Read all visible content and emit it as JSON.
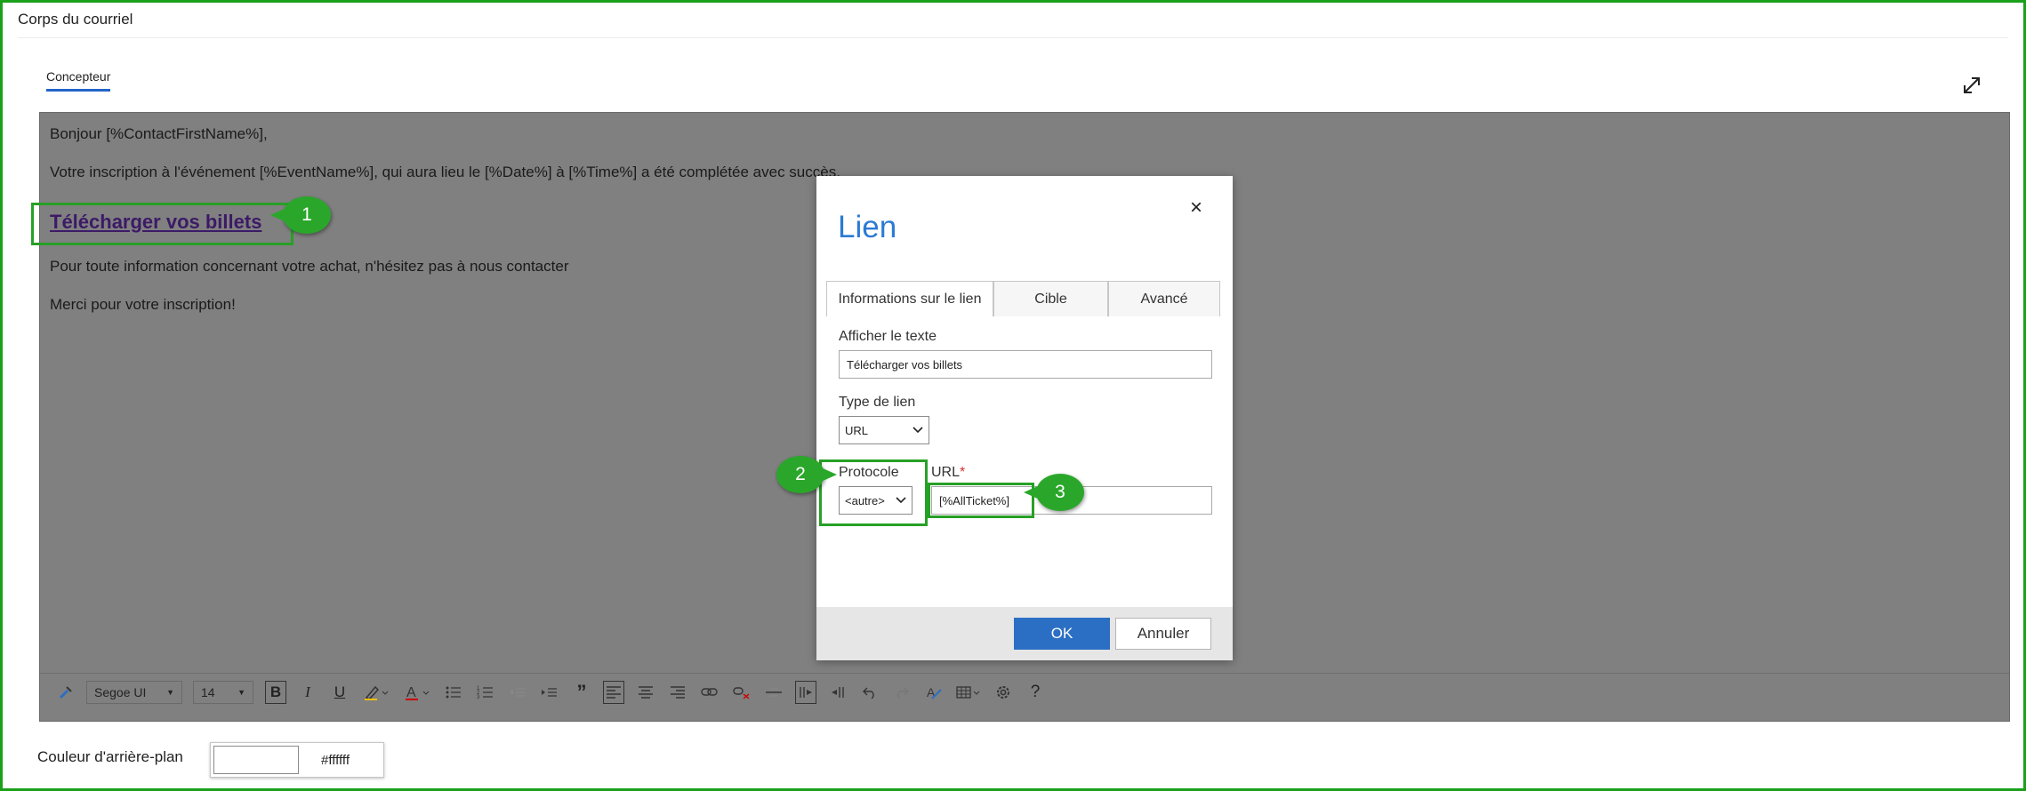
{
  "section": {
    "title": "Corps du courriel"
  },
  "designer_tab": {
    "label": "Concepteur"
  },
  "icons": {
    "expand": "expand-diagonal-icon",
    "close": "close-icon",
    "toolbar": [
      "format-painter-icon",
      "bold-icon",
      "italic-icon",
      "underline-icon",
      "highlight-icon",
      "font-color-icon",
      "bulleted-list-icon",
      "numbered-list-icon",
      "outdent-icon",
      "indent-icon",
      "quote-icon",
      "align-left-icon",
      "align-center-icon",
      "align-right-icon",
      "link-icon",
      "unlink-icon",
      "strikethrough-icon",
      "ltr-icon",
      "rtl-icon",
      "undo-icon",
      "redo-icon",
      "clear-format-icon",
      "table-icon",
      "settings-icon",
      "help-icon"
    ]
  },
  "email": {
    "greeting": "Bonjour [%ContactFirstName%],",
    "confirmation": "Votre inscription à l'événement [%EventName%], qui aura lieu le [%Date%] à [%Time%]  a été complétée avec succès.",
    "link_text": "Télécharger vos billets",
    "info": "Pour toute information concernant votre achat, n'hésitez pas à nous contacter",
    "thanks": "Merci pour votre inscription!"
  },
  "callouts": [
    "1",
    "2",
    "3"
  ],
  "toolbar": {
    "font_family": "Segoe UI",
    "font_size": "14",
    "quote_glyph": "”",
    "help_glyph": "?"
  },
  "dialog": {
    "title": "Lien",
    "close_glyph": "×",
    "tabs": [
      "Informations sur le lien",
      "Cible",
      "Avancé"
    ],
    "display_text_label": "Afficher le texte",
    "display_text_value": "Télécharger vos billets",
    "link_type_label": "Type de lien",
    "link_type_value": "URL",
    "protocol_label": "Protocole",
    "protocol_value": "<autre>",
    "url_label": "URL",
    "url_required": "*",
    "url_value": "[%AllTicket%]",
    "ok_label": "OK",
    "cancel_label": "Annuler"
  },
  "background": {
    "label": "Couleur d'arrière-plan",
    "color": "#ffffff",
    "hex_text": "#ffffff"
  },
  "colors": {
    "accent": "#2b7ad4",
    "callout": "#2aa72a",
    "frame": "#1aa01a",
    "ok_button": "#2b6fc4"
  }
}
